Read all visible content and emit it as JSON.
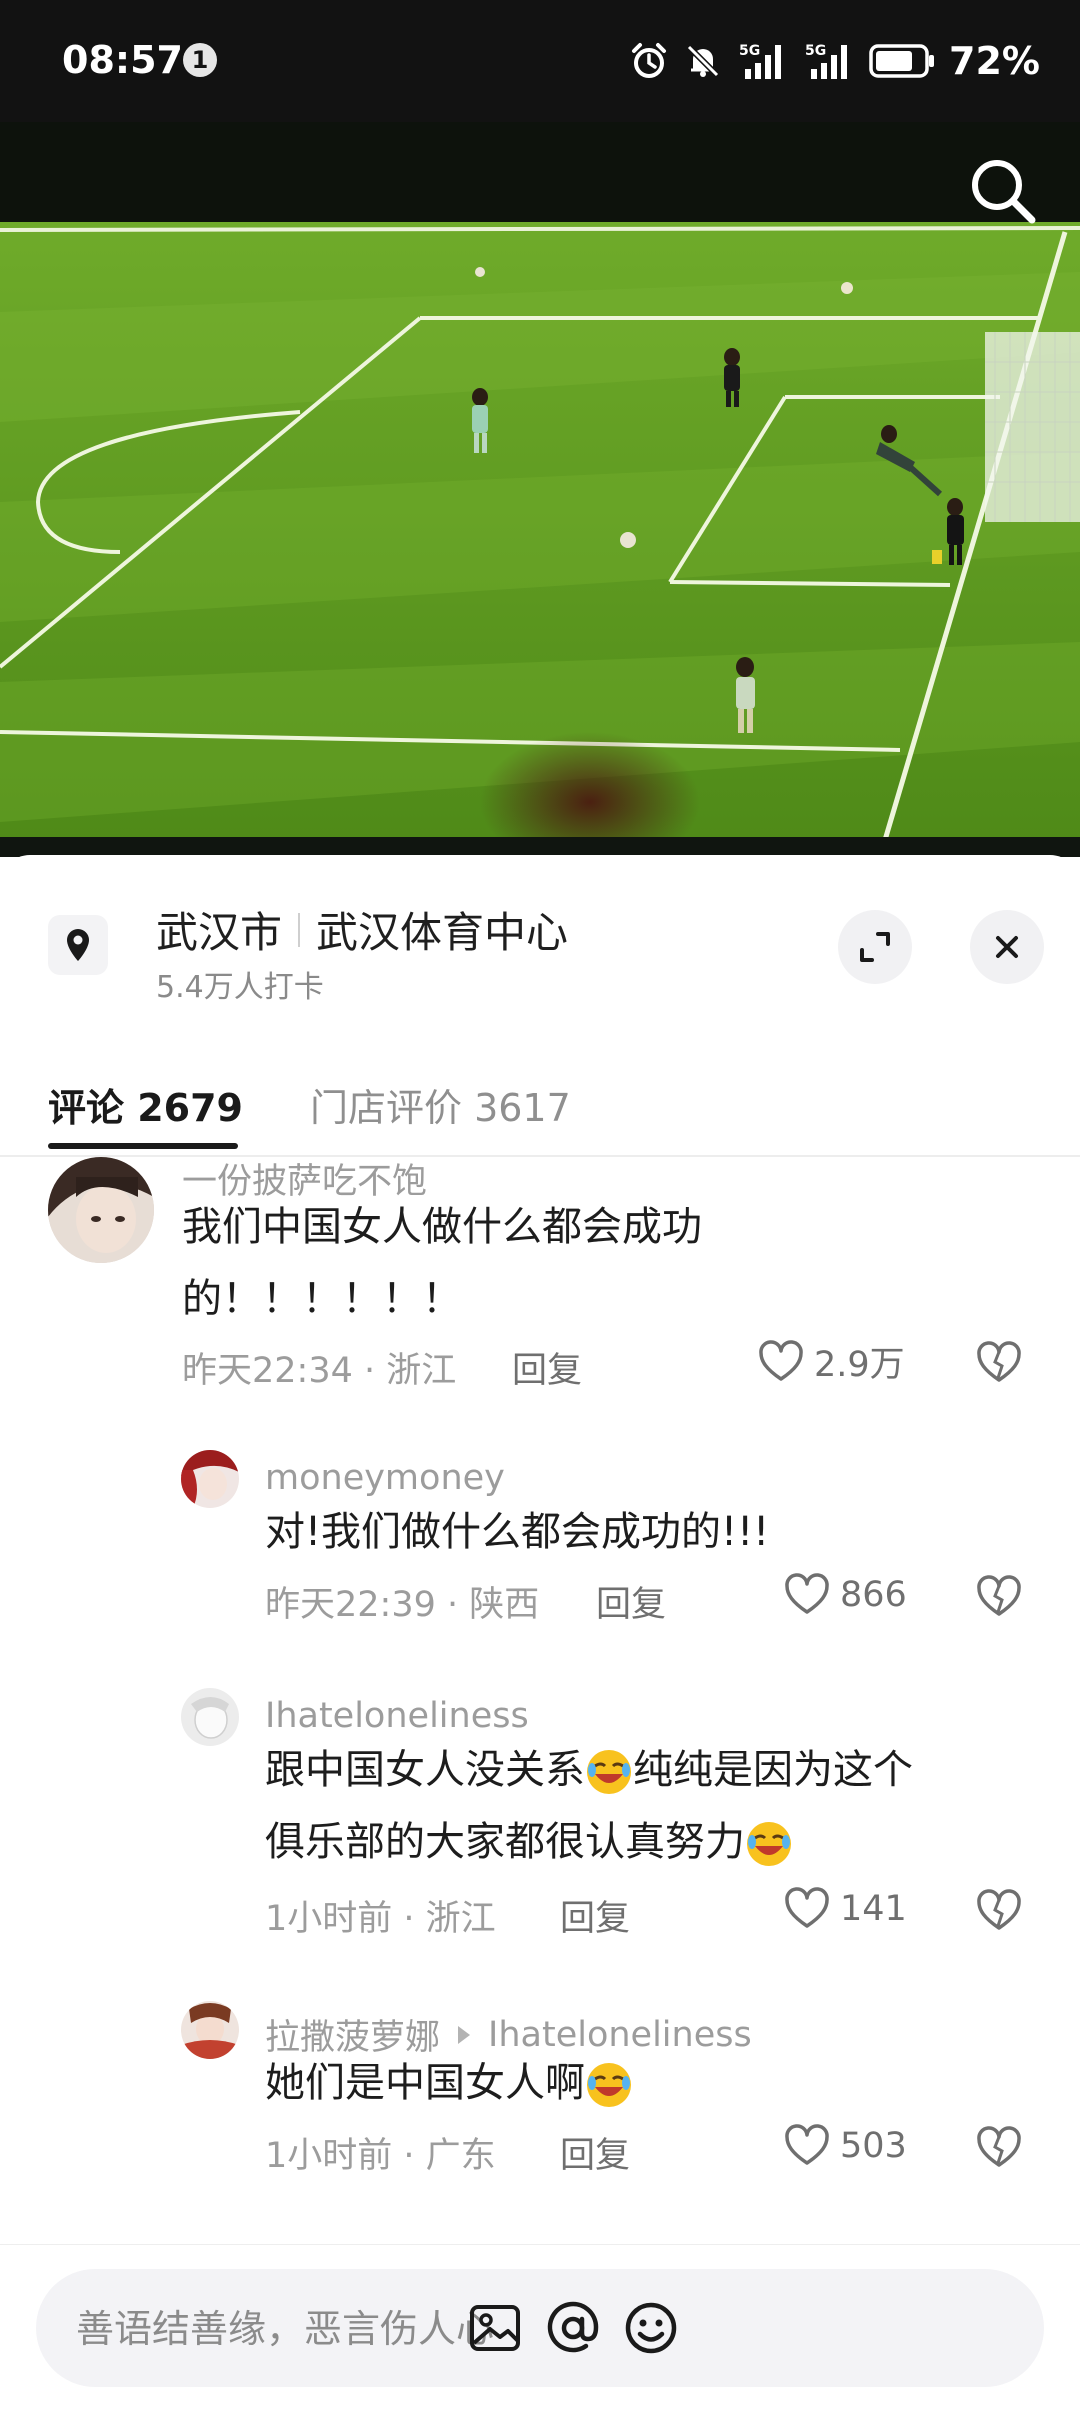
{
  "status_bar": {
    "time": "08:57",
    "notification_count": "1",
    "battery": "72%",
    "icons": [
      "alarm-icon",
      "mute-icon",
      "signal-5g-icon",
      "signal-5g-icon",
      "battery-icon"
    ]
  },
  "video": {
    "search_icon": "search-icon"
  },
  "location": {
    "city": "武汉市",
    "venue": "武汉体育中心",
    "checkins": "5.4万人打卡"
  },
  "tabs": [
    {
      "label": "评论 2679",
      "active": true
    },
    {
      "label": "门店评价 3617",
      "active": false
    }
  ],
  "comments": [
    {
      "user": "一份披萨吃不饱",
      "text_line1": "我们中国女人做什么都会成功",
      "text_line2": "的！！！！！！",
      "meta": "昨天22:34 · 浙江",
      "reply": "回复",
      "likes": "2.9万"
    },
    {
      "user": "moneymoney",
      "text": "对!我们做什么都会成功的!!!",
      "meta": "昨天22:39 · 陕西",
      "reply": "回复",
      "likes": "866"
    },
    {
      "user": "Ihateloneliness",
      "text_a": "跟中国女人没关系",
      "text_b": "纯纯是因为这个",
      "text_c": "俱乐部的大家都很认真努力",
      "meta": "1小时前 · 浙江",
      "reply": "回复",
      "likes": "141"
    },
    {
      "user": "拉撒菠萝娜",
      "reply_to": "Ihateloneliness",
      "text": "她们是中国女人啊",
      "meta": "1小时前 · 广东",
      "reply": "回复",
      "likes": "503"
    }
  ],
  "input": {
    "placeholder": "善语结善缘，恶言伤人心",
    "icons": [
      "image-icon",
      "mention-icon",
      "emoji-icon"
    ]
  },
  "colors": {
    "status_bg": "#121212",
    "pitch_green": "#5e9a1f",
    "text_primary": "#1d1d1d",
    "text_secondary": "#9c9c9c"
  }
}
